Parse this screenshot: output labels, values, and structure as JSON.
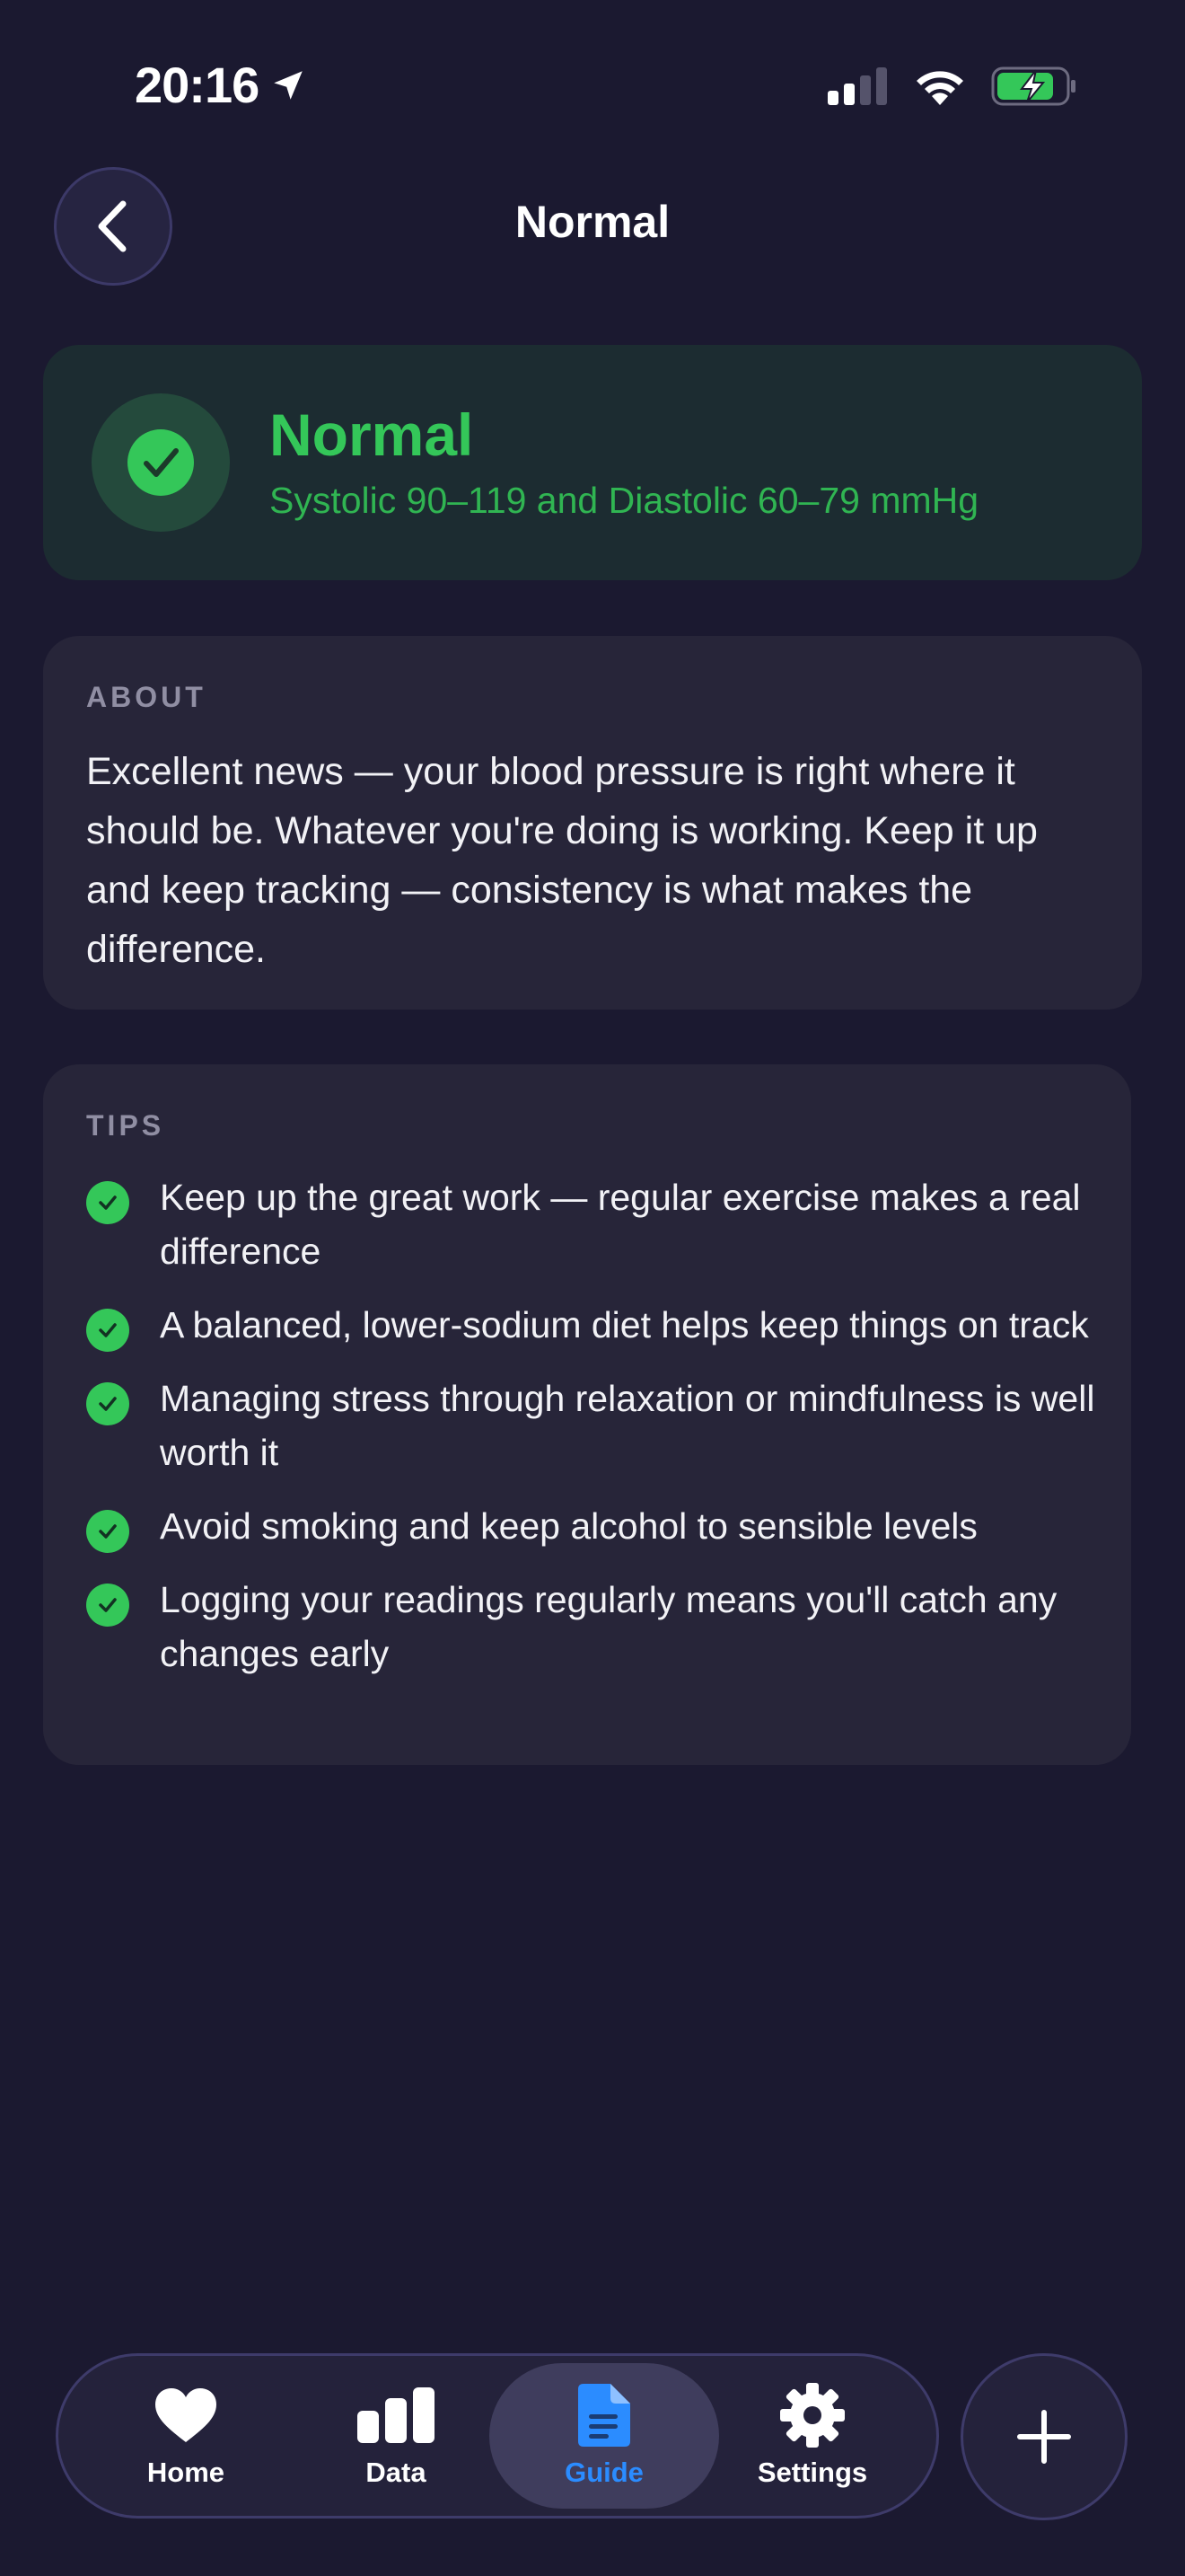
{
  "status_bar": {
    "time": "20:16",
    "location_icon": "location-arrow-icon",
    "signal_icon": "cellular-signal-icon",
    "wifi_icon": "wifi-icon",
    "battery_icon": "battery-charging-icon"
  },
  "nav": {
    "back_icon": "chevron-left-icon",
    "title": "Normal"
  },
  "category": {
    "icon": "checkmark-circle-icon",
    "title": "Normal",
    "range": "Systolic 90–119 and Diastolic 60–79 mmHg",
    "color": "#34c759"
  },
  "about": {
    "label": "ABOUT",
    "text": "Excellent news — your blood pressure is right where it should be. Whatever you're doing is working. Keep it up and keep tracking — consistency is what makes the difference."
  },
  "tips": {
    "label": "TIPS",
    "items": [
      "Keep up the great work — regular exercise makes a real difference",
      "A balanced, lower-sodium diet helps keep things on track",
      "Managing stress through relaxation or mindfulness is well worth it",
      "Avoid smoking and keep alcohol to sensible levels",
      "Logging your readings regularly means you'll catch any changes early"
    ]
  },
  "tab_bar": {
    "tabs": [
      {
        "label": "Home",
        "icon": "heart-icon"
      },
      {
        "label": "Data",
        "icon": "bar-chart-icon"
      },
      {
        "label": "Guide",
        "icon": "document-icon",
        "active": true
      },
      {
        "label": "Settings",
        "icon": "gear-icon"
      }
    ],
    "add_icon": "plus-icon",
    "accent_color": "#2b8cff"
  }
}
